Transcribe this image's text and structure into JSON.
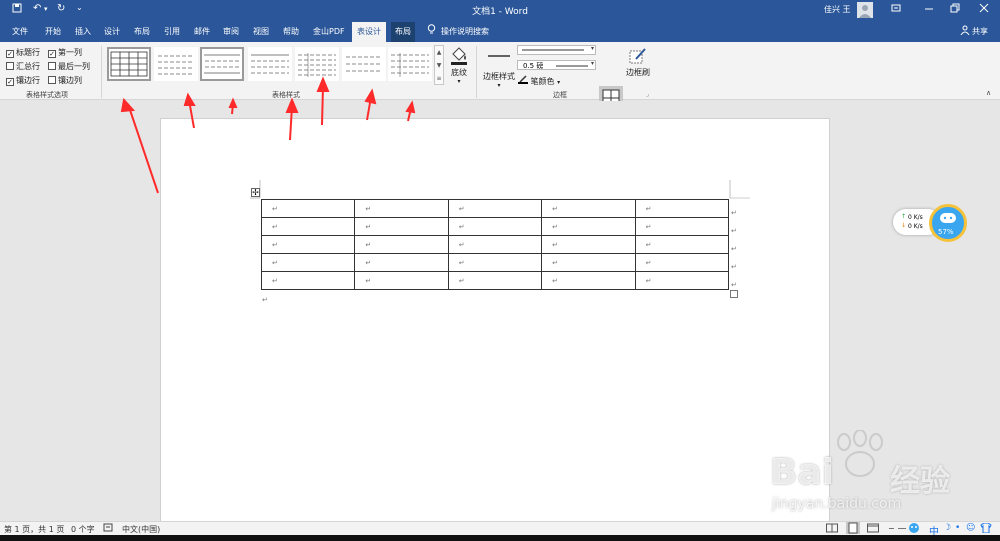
{
  "titlebar": {
    "doc_title": "文档1  -  Word",
    "user": "佳兴 王",
    "undo": "↶",
    "redo": "↻",
    "more": "⌄"
  },
  "menubar": {
    "tabs": [
      "文件",
      "开始",
      "插入",
      "设计",
      "布局",
      "引用",
      "邮件",
      "审阅",
      "视图",
      "帮助",
      "金山PDF",
      "表设计",
      "布局"
    ],
    "tell_me": "操作说明搜索",
    "share": "共享"
  },
  "ribbon": {
    "style_options": {
      "label": "表格样式选项",
      "items": [
        {
          "label": "标题行",
          "checked": true
        },
        {
          "label": "第一列",
          "checked": true
        },
        {
          "label": "汇总行",
          "checked": false
        },
        {
          "label": "最后一列",
          "checked": false
        },
        {
          "label": "镶边行",
          "checked": true
        },
        {
          "label": "镶边列",
          "checked": false
        }
      ]
    },
    "table_styles": {
      "label": "表格样式",
      "shading": "底纹"
    },
    "borders": {
      "label": "边框",
      "border_styles": "边框样式",
      "weight": "0.5 磅",
      "pen_color": "笔颜色",
      "border": "边框",
      "border_painter": "边框刷"
    }
  },
  "statusbar": {
    "page": "第 1 页，共 1 页",
    "words": "0 个字",
    "lang": "中文(中国)",
    "ime": "中"
  },
  "netwidget": {
    "up": "0  K/s",
    "down": "0  K/s",
    "percent": "57%"
  },
  "watermark": {
    "brand": "Bai",
    "brand2": "经验",
    "url": "jingyan.baidu.com"
  },
  "colors": {
    "word_blue": "#2b579a",
    "arrow_red": "#ff2a2a"
  }
}
